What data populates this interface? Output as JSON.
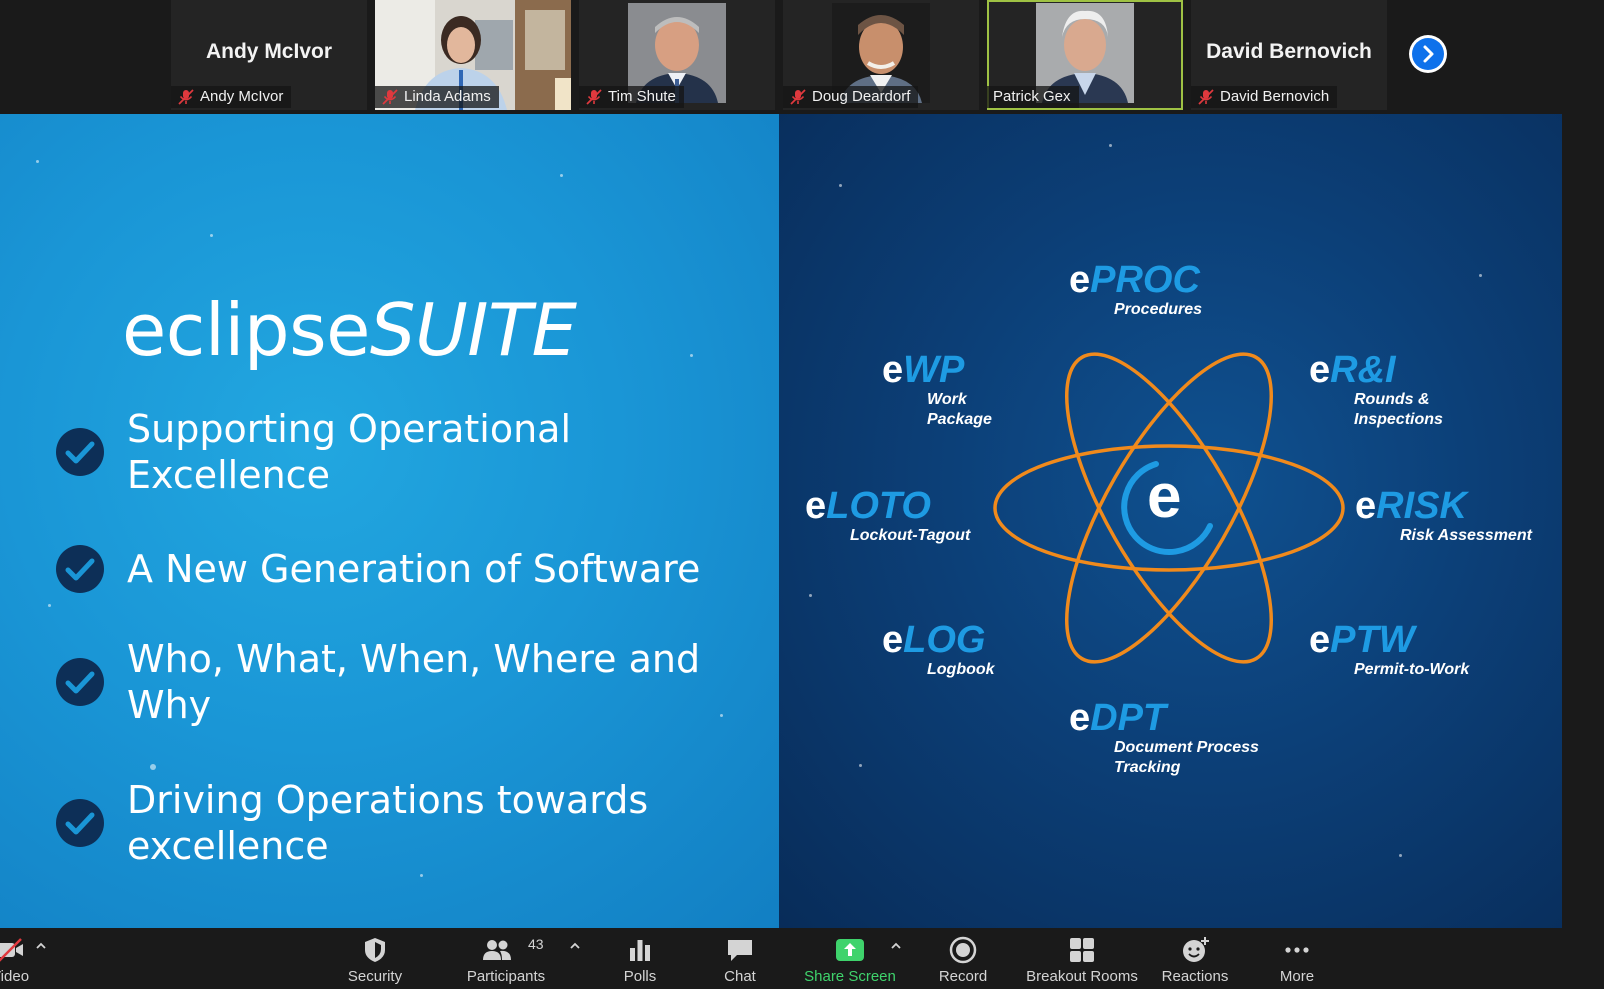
{
  "participants": {
    "tiles": [
      {
        "name": "Andy McIvor",
        "big_name": "Andy McIvor",
        "muted": true,
        "video": false
      },
      {
        "name": "Linda Adams",
        "muted": true,
        "video": true
      },
      {
        "name": "Tim Shute",
        "muted": true,
        "video": true
      },
      {
        "name": "Doug Deardorf",
        "muted": true,
        "video": true
      },
      {
        "name": "Patrick Gex",
        "muted": false,
        "video": true,
        "active_speaker": true
      },
      {
        "name": "David Bernovich",
        "big_name": "David Bernovich",
        "muted": true,
        "video": false
      }
    ],
    "next_icon": "chevron-right-icon"
  },
  "slide": {
    "title_regular": "eclipse",
    "title_italic": "SUITE",
    "bullets": [
      {
        "line1": "Supporting Operational",
        "line2": "Excellence"
      },
      {
        "line1": "A New Generation of Software",
        "line2": ""
      },
      {
        "line1": "Who, What, When, Where and",
        "line2": "Why"
      },
      {
        "line1": "Driving Operations towards",
        "line2": "excellence"
      }
    ],
    "center_logo": "e",
    "products": [
      {
        "e": "e",
        "code": "PROC",
        "desc1": "Procedures",
        "desc2": ""
      },
      {
        "e": "e",
        "code": "WP",
        "desc1": "Work",
        "desc2": "Package"
      },
      {
        "e": "e",
        "code": "R&I",
        "desc1": "Rounds &",
        "desc2": "Inspections"
      },
      {
        "e": "e",
        "code": "LOTO",
        "desc1": "Lockout-Tagout",
        "desc2": ""
      },
      {
        "e": "e",
        "code": "RISK",
        "desc1": "Risk Assessment",
        "desc2": ""
      },
      {
        "e": "e",
        "code": "LOG",
        "desc1": "Logbook",
        "desc2": ""
      },
      {
        "e": "e",
        "code": "PTW",
        "desc1": "Permit-to-Work",
        "desc2": ""
      },
      {
        "e": "e",
        "code": "DPT",
        "desc1": "Document Process",
        "desc2": "Tracking"
      }
    ],
    "colors": {
      "accent_blue": "#1e9be3",
      "orbit_orange": "#f08a1c",
      "check_navy": "#0d2f57"
    }
  },
  "toolbar": {
    "video_label": "Video",
    "security_label": "Security",
    "participants_label": "Participants",
    "participants_count": "43",
    "polls_label": "Polls",
    "chat_label": "Chat",
    "share_label": "Share Screen",
    "record_label": "Record",
    "breakout_label": "Breakout Rooms",
    "reactions_label": "Reactions",
    "more_label": "More",
    "share_color": "#3fd36c"
  }
}
